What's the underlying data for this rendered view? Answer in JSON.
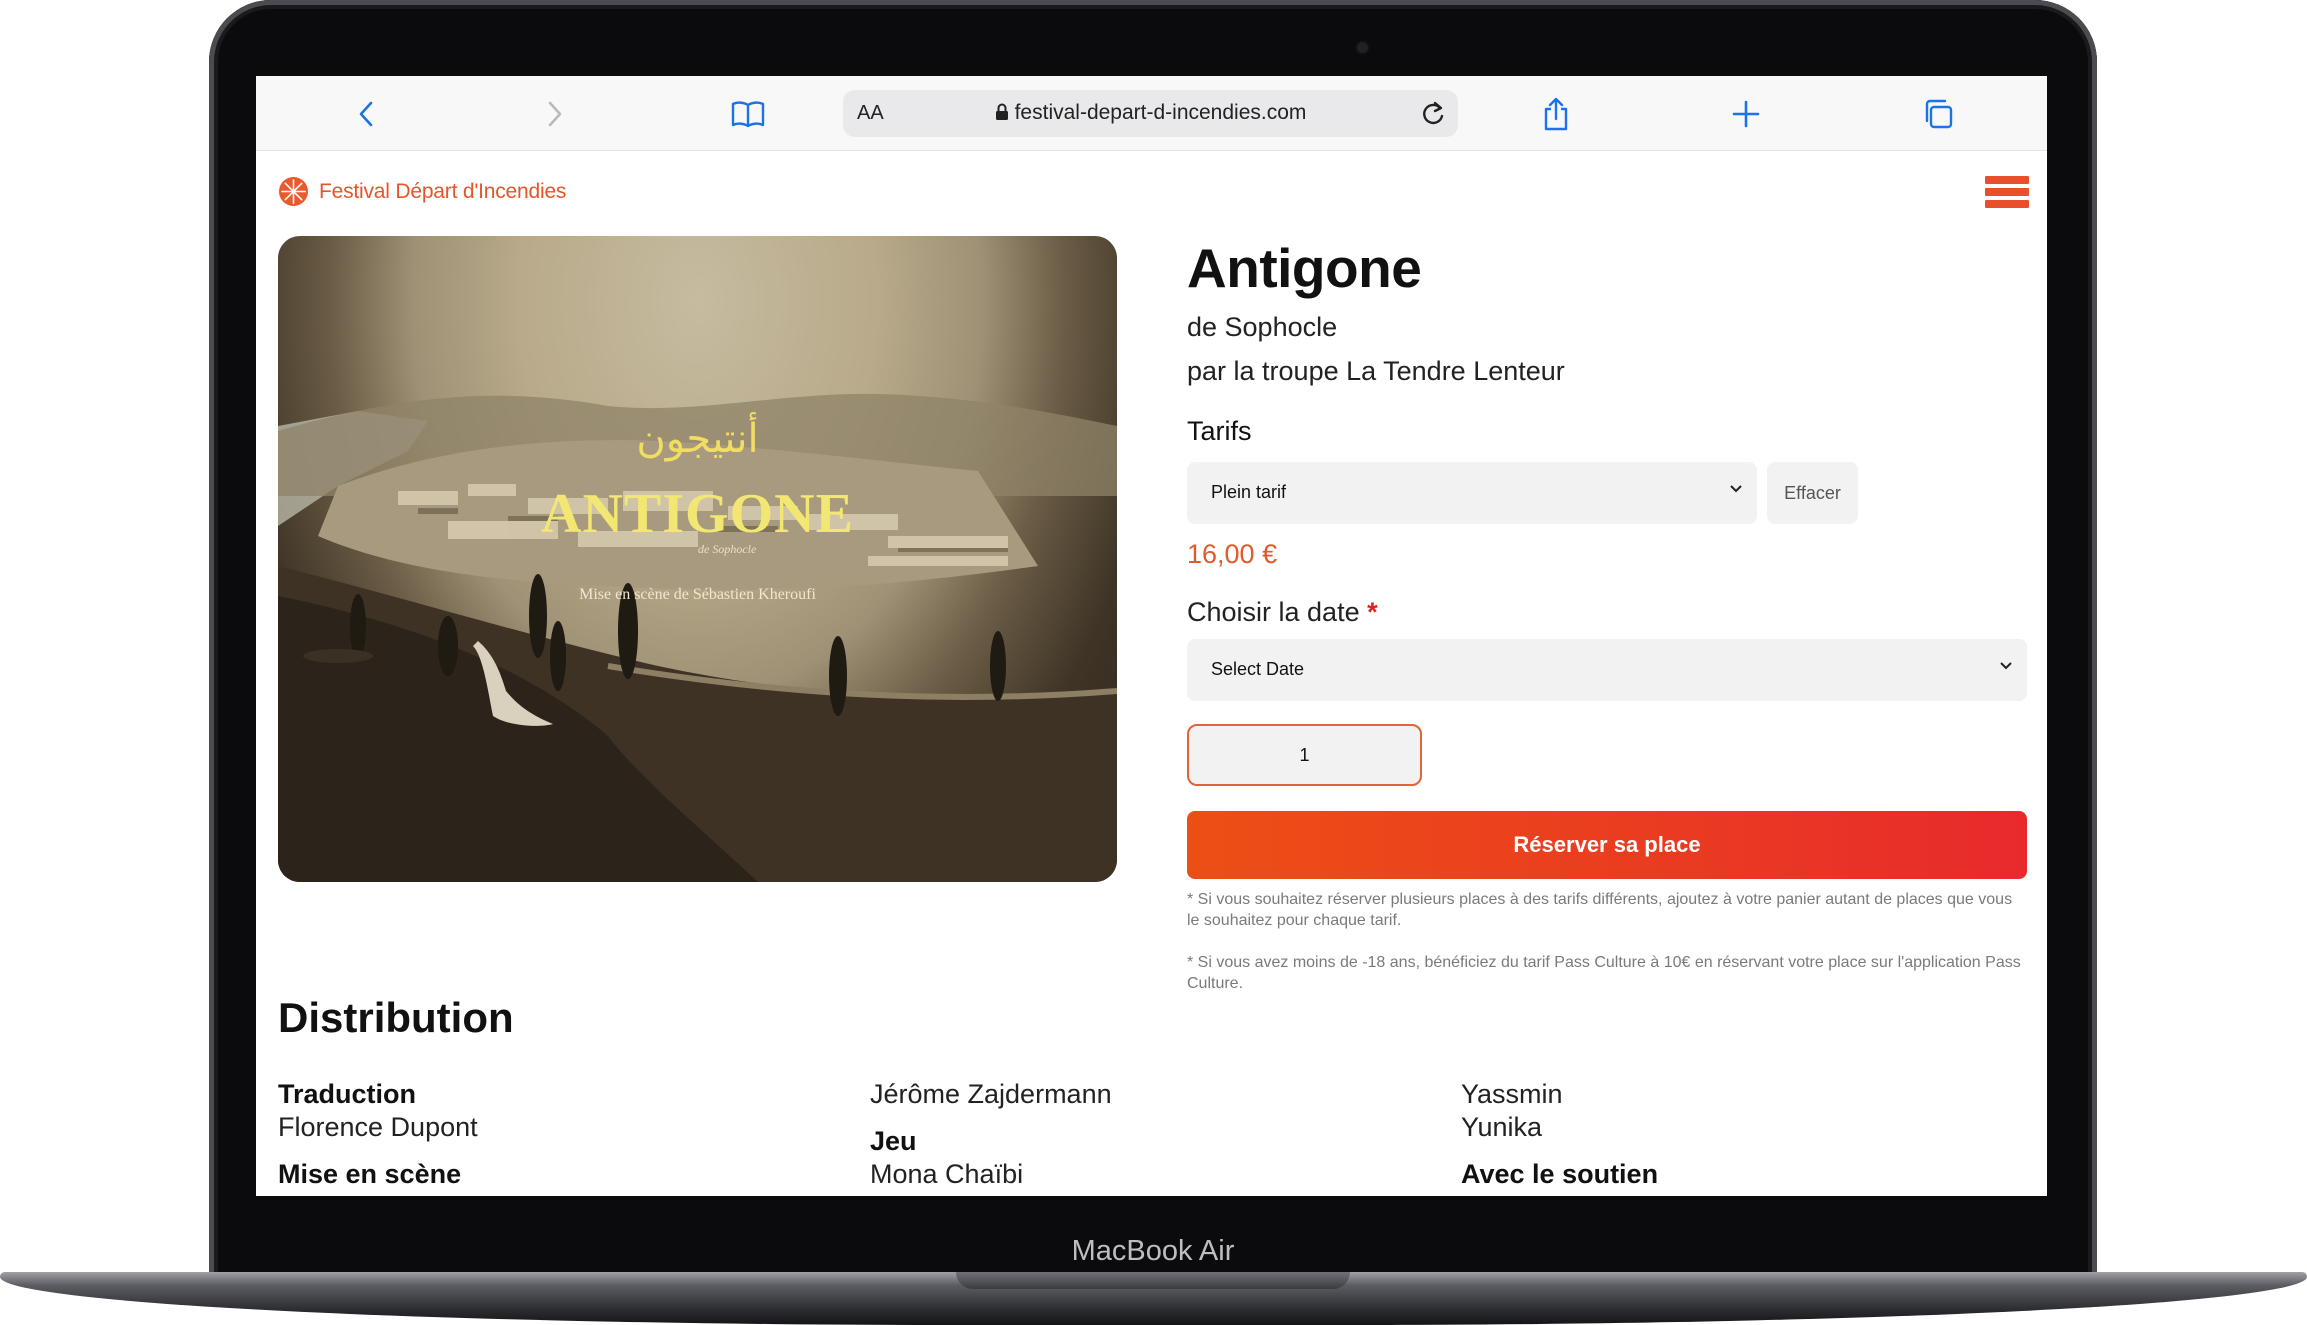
{
  "device": {
    "label": "MacBook Air"
  },
  "browser": {
    "url": "festival-depart-d-incendies.com",
    "aa": "AA",
    "icons": [
      "back-icon",
      "forward-icon",
      "bookmarks-icon",
      "lock-icon",
      "reload-icon",
      "share-icon",
      "plus-icon",
      "tabs-icon"
    ]
  },
  "site": {
    "name": "Festival Départ d'Incendies",
    "brand_color": "#e8542a"
  },
  "hero": {
    "arabic": "أنتيجون",
    "title": "ANTIGONE",
    "subtitle": "de Sophocle",
    "credit": "Mise en scène de Sébastien Kheroufi"
  },
  "product": {
    "title": "Antigone",
    "author": "de Sophocle",
    "troupe": "par la troupe La Tendre Lenteur",
    "tarifs_label": "Tarifs",
    "tarif_selected": "Plein tarif",
    "clear_label": "Effacer",
    "price": "16,00 €",
    "date_label": "Choisir la date",
    "required_mark": "*",
    "date_selected": "Select Date",
    "quantity": "1",
    "reserve_label": "Réserver sa place",
    "note1": "* Si vous souhaitez réserver plusieurs places à des tarifs différents, ajoutez à votre panier autant de places que vous le souhaitez pour chaque tarif.",
    "note2": "* Si vous avez moins de -18 ans, bénéficiez du tarif Pass Culture à 10€ en réservant votre place sur l'application Pass Culture."
  },
  "distribution": {
    "title": "Distribution",
    "col1": [
      {
        "role": "Traduction",
        "names": [
          "Florence Dupont"
        ]
      },
      {
        "role": "Mise en scène"
      }
    ],
    "col2": [
      {
        "names": [
          "Jérôme Zajdermann"
        ]
      },
      {
        "role": "Jeu",
        "names": [
          "Mona Chaïbi"
        ]
      }
    ],
    "col3": [
      {
        "names": [
          "Yassmin",
          "Yunika"
        ]
      },
      {
        "role": "Avec le soutien"
      }
    ]
  }
}
